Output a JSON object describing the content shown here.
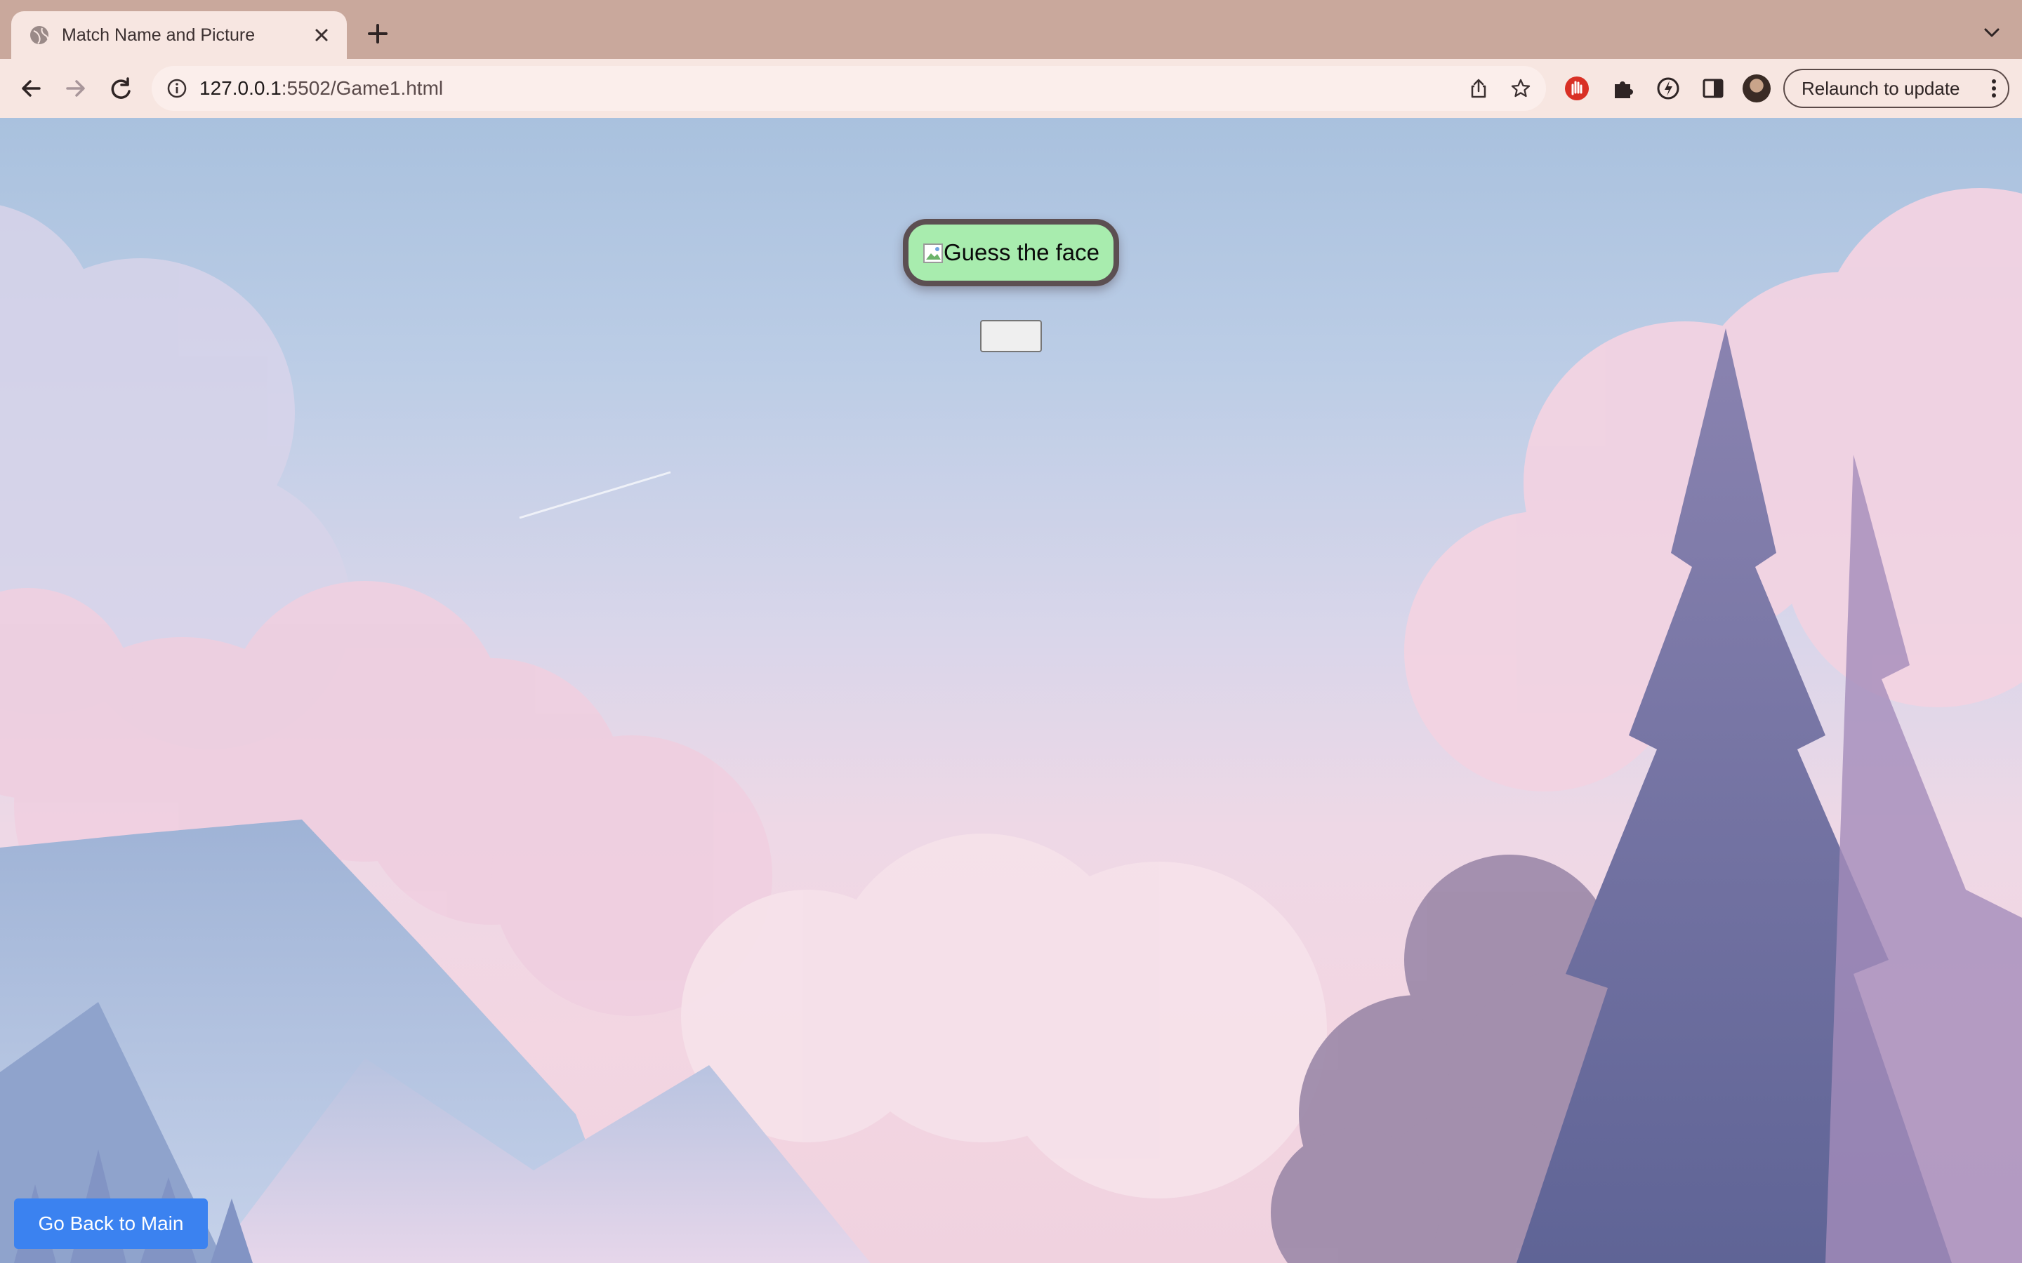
{
  "browser": {
    "tab": {
      "title": "Match Name and Picture",
      "close_icon": "close-icon"
    },
    "new_tab_icon": "plus-icon",
    "toolbar": {
      "url_host": "127.0.0.1",
      "url_rest": ":5502/Game1.html",
      "relaunch_label": "Relaunch to update"
    },
    "colors": {
      "tabstrip": "#c9a89c",
      "toolbar": "#f7e6e1",
      "accent_extension": "#d93025"
    }
  },
  "page": {
    "title": "Guess the face",
    "answer_button_label": "",
    "back_button_label": "Go Back to Main",
    "colors": {
      "title_pill": "#a8ecae",
      "back_button": "#3b82f0"
    }
  }
}
